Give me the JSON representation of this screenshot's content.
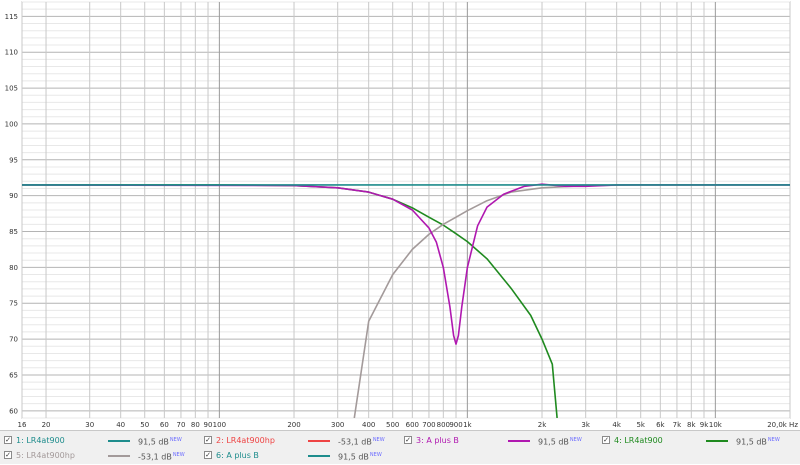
{
  "chart_data": {
    "type": "line",
    "title": "",
    "xlabel": "",
    "ylabel": "",
    "x_scale": "log",
    "xlim": [
      16,
      20000
    ],
    "ylim": [
      59,
      117
    ],
    "grid": true,
    "y_ticks": [
      "115",
      "110",
      "105",
      "100",
      "95",
      "90",
      "85",
      "80",
      "75",
      "70",
      "65",
      "60"
    ],
    "y_tick_values": [
      115,
      110,
      105,
      100,
      95,
      90,
      85,
      80,
      75,
      70,
      65,
      60
    ],
    "x_ticks": [
      "16",
      "20",
      "30",
      "40",
      "50",
      "60",
      "70",
      "80",
      "90",
      "100",
      "200",
      "300",
      "400",
      "500",
      "600",
      "700",
      "800",
      "900",
      "1k",
      "2k",
      "3k",
      "4k",
      "5k",
      "6k",
      "7k",
      "8k",
      "9k",
      "10k",
      "20,0k Hz"
    ],
    "x_tick_values": [
      16,
      20,
      30,
      40,
      50,
      60,
      70,
      80,
      90,
      100,
      200,
      300,
      400,
      500,
      600,
      700,
      800,
      900,
      1000,
      2000,
      3000,
      4000,
      5000,
      6000,
      7000,
      8000,
      9000,
      10000,
      20000
    ],
    "series": [
      {
        "name": "4: LR4at900",
        "color": "#1f8a1f",
        "x": [
          16,
          100,
          200,
          300,
          400,
          500,
          600,
          700,
          800,
          900,
          1000,
          1200,
          1500,
          1800,
          2000,
          2200,
          2300
        ],
        "y": [
          91.5,
          91.5,
          91.4,
          91.1,
          90.5,
          89.5,
          88.3,
          87.0,
          85.9,
          84.7,
          83.6,
          81.2,
          77.1,
          73.3,
          70.0,
          66.5,
          59
        ]
      },
      {
        "name": "5: LR4at900hp",
        "color": "#a39a9a",
        "x": [
          350,
          400,
          500,
          600,
          700,
          800,
          900,
          1000,
          1200,
          1500,
          2000,
          3000,
          5000,
          20000
        ],
        "y": [
          59,
          72.5,
          79.0,
          82.5,
          84.6,
          86.0,
          87.0,
          87.9,
          89.3,
          90.5,
          91.1,
          91.4,
          91.5,
          91.5
        ]
      },
      {
        "name": "3: A plus B",
        "color": "#b018b0",
        "x": [
          16,
          200,
          300,
          400,
          500,
          600,
          700,
          750,
          800,
          850,
          880,
          900,
          920,
          950,
          1000,
          1100,
          1200,
          1400,
          1700,
          2000,
          2500,
          3000,
          4000,
          20000
        ],
        "y": [
          91.5,
          91.4,
          91.1,
          90.5,
          89.5,
          88.0,
          85.5,
          83.5,
          80.0,
          74.5,
          70.5,
          69.3,
          70.5,
          74.5,
          80.0,
          85.8,
          88.4,
          90.2,
          91.3,
          91.6,
          91.3,
          91.3,
          91.5,
          91.5
        ]
      },
      {
        "name": "6: A plus B",
        "color": "#1e8c8c",
        "x": [
          16,
          20000
        ],
        "y": [
          91.5,
          91.5
        ]
      }
    ]
  },
  "legend": {
    "entries": [
      {
        "label": "1: LR4at900",
        "value": "91,5 dB",
        "new": "NEW",
        "color": "#1e8c8c",
        "checked": "✓"
      },
      {
        "label": "2: LR4at900hp",
        "value": "-53,1 dB",
        "new": "NEW",
        "color": "#ee4444",
        "checked": "✓"
      },
      {
        "label": "3: A plus B",
        "value": "91,5 dB",
        "new": "NEW",
        "color": "#b018b0",
        "checked": "✓"
      },
      {
        "label": "4: LR4at900",
        "value": "91,5 dB",
        "new": "NEW",
        "color": "#1f8a1f",
        "checked": "✓"
      },
      {
        "label": "5: LR4at900hp",
        "value": "-53,1 dB",
        "new": "NEW",
        "color": "#a39a9a",
        "checked": "✓"
      },
      {
        "label": "6: A plus B",
        "value": "91,5 dB",
        "new": "NEW",
        "color": "#1e8c8c",
        "checked": "✓"
      }
    ]
  }
}
